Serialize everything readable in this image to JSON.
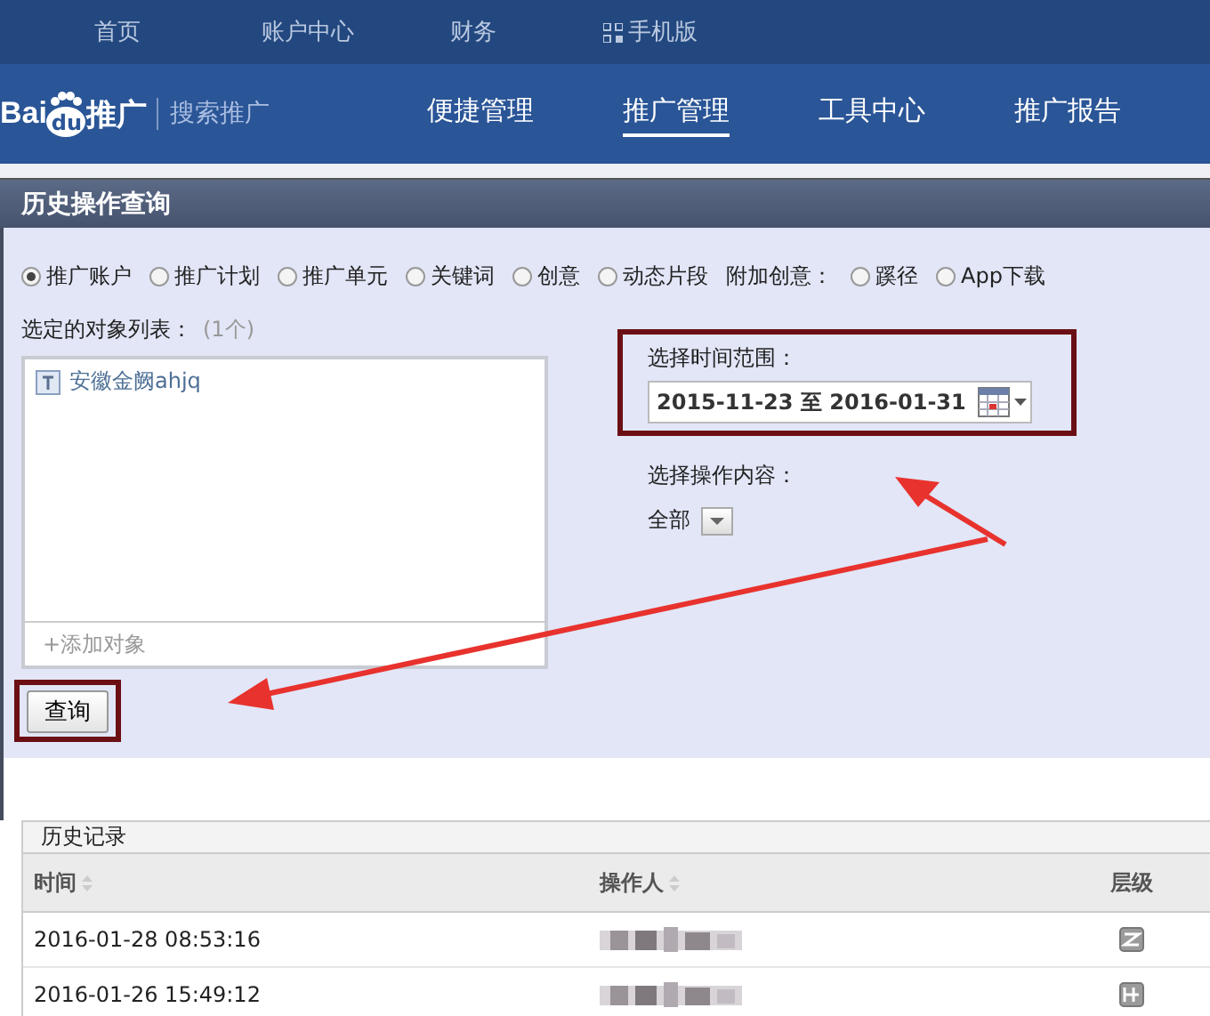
{
  "top_nav": [
    {
      "label": "首页",
      "kind": "plain"
    },
    {
      "label": "账户中心",
      "kind": "plain"
    },
    {
      "label": "财务",
      "kind": "plain"
    },
    {
      "label": "手机版",
      "kind": "mobile"
    }
  ],
  "logo": {
    "brand_start": "Bai",
    "brand_end": "du",
    "product": "推广",
    "subtitle": "搜索推广"
  },
  "main_nav": [
    {
      "label": "便捷管理",
      "selected": false
    },
    {
      "label": "推广管理",
      "selected": true
    },
    {
      "label": "工具中心",
      "selected": false
    },
    {
      "label": "推广报告",
      "selected": false
    }
  ],
  "panel": {
    "title": "历史操作查询"
  },
  "scope_options": [
    {
      "kind": "radio",
      "label": "推广账户",
      "selected": true
    },
    {
      "kind": "radio",
      "label": "推广计划",
      "selected": false
    },
    {
      "kind": "radio",
      "label": "推广单元",
      "selected": false
    },
    {
      "kind": "radio",
      "label": "关键词",
      "selected": false
    },
    {
      "kind": "radio",
      "label": "创意",
      "selected": false
    },
    {
      "kind": "radio",
      "label": "动态片段",
      "selected": false
    },
    {
      "kind": "label",
      "label": "附加创意："
    },
    {
      "kind": "radio",
      "label": "蹊径",
      "selected": false
    },
    {
      "kind": "radio",
      "label": "App下载",
      "selected": false
    }
  ],
  "object_list": {
    "label": "选定的对象列表：",
    "count": "(1个)",
    "items": [
      {
        "name": "安徽金阙ahjq"
      }
    ],
    "add": "+添加对象"
  },
  "query_button": "查询",
  "time_range": {
    "label": "选择时间范围：",
    "value": "2015-11-23 至 2016-01-31"
  },
  "operation": {
    "label": "选择操作内容：",
    "value": "全部"
  },
  "history": {
    "title": "历史记录",
    "columns": [
      {
        "label": "时间",
        "sortable": true
      },
      {
        "label": "操作人",
        "sortable": true
      },
      {
        "label": "层级",
        "sortable": false
      }
    ],
    "rows": [
      {
        "time": "2016-01-28 08:53:16"
      },
      {
        "time": "2016-01-26 15:49:12"
      }
    ]
  }
}
